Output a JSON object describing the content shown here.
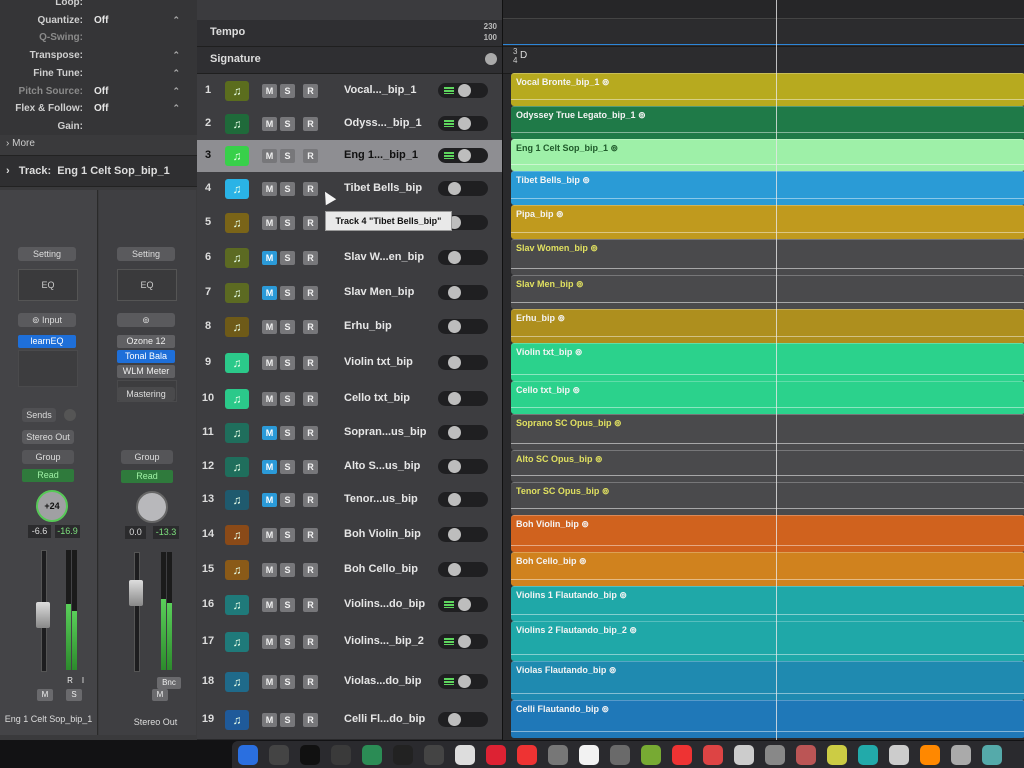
{
  "region_inspector": {
    "params": [
      {
        "label": "Loop:",
        "value": "",
        "chevron": false,
        "dim": false
      },
      {
        "label": "Quantize:",
        "value": "Off",
        "chevron": true,
        "dim": false
      },
      {
        "label": "Q-Swing:",
        "value": "",
        "chevron": false,
        "dim": true
      },
      {
        "label": "Transpose:",
        "value": "",
        "chevron": true,
        "dim": false
      },
      {
        "label": "Fine Tune:",
        "value": "",
        "chevron": true,
        "dim": false
      },
      {
        "label": "Pitch Source:",
        "value": "Off",
        "chevron": true,
        "dim": true
      },
      {
        "label": "Flex & Follow:",
        "value": "Off",
        "chevron": true,
        "dim": false
      },
      {
        "label": "Gain:",
        "value": "",
        "chevron": false,
        "dim": false
      }
    ],
    "more": "More"
  },
  "track_inspector": {
    "title": "Track:",
    "track_name": "Eng 1 Celt Sop_bip_1"
  },
  "strip1": {
    "setting": "Setting",
    "eq": "EQ",
    "input": "Input",
    "plugin": "learnEQ",
    "sends": "Sends",
    "output": "Stereo Out",
    "group": "Group",
    "read": "Read",
    "knob": "+24",
    "vol": "-6.6",
    "peak": "-16.9",
    "ri_r": "R",
    "ri_i": "I",
    "m": "M",
    "s": "S",
    "name": "Eng 1 Celt Sop_bip_1",
    "meter_level": 0.55
  },
  "strip2": {
    "setting": "Setting",
    "eq": "EQ",
    "plugins": [
      "Ozone 12",
      "Tonal Bala",
      "WLM Meter"
    ],
    "mastering": "Mastering",
    "group": "Group",
    "read": "Read",
    "vol": "0.0",
    "peak": "-13.3",
    "m": "M",
    "s": "S",
    "bnc": "Bnc",
    "name": "Stereo Out",
    "meter_level": 0.6
  },
  "global_tracks": {
    "tempo_label": "Tempo",
    "tempo_hi": "230",
    "tempo_lo": "100",
    "signature_label": "Signature",
    "sig_num": "3",
    "sig_den": "4",
    "key": "D"
  },
  "tooltip": "Track 4 \"Tibet Bells_bip\"",
  "tracks": [
    {
      "num": "1",
      "name": "Vocal..._bip_1",
      "m_on": false,
      "on": true,
      "region": "Vocal Bronte_bip_1",
      "color": "#b7aa1f",
      "icon_color": "#5b6d1e"
    },
    {
      "num": "2",
      "name": "Odyss..._bip_1",
      "m_on": false,
      "on": true,
      "region": "Odyssey True Legato_bip_1",
      "color": "#1f7a48",
      "icon_color": "#1f6a3a"
    },
    {
      "num": "3",
      "name": "Eng 1..._bip_1",
      "m_on": false,
      "on": true,
      "region": "Eng 1 Celt Sop_bip_1",
      "color": "#9ef0a8",
      "icon_color": "#38d04a"
    },
    {
      "num": "4",
      "name": "Tibet Bells_bip",
      "m_on": false,
      "on": false,
      "region": "Tibet Bells_bip",
      "color": "#2a9bd6",
      "icon_color": "#2ab3e6"
    },
    {
      "num": "5",
      "name": "",
      "m_on": false,
      "on": false,
      "region": "Pipa_bip",
      "color": "#c09a1e",
      "icon_color": "#7a6418"
    },
    {
      "num": "6",
      "name": "Slav W...en_bip",
      "m_on": true,
      "on": false,
      "region": "Slav Women_bip",
      "color": "#4a4a4c",
      "icon_color": "#5c6a22"
    },
    {
      "num": "7",
      "name": "Slav Men_bip",
      "m_on": true,
      "on": false,
      "region": "Slav Men_bip",
      "color": "#4a4a4c",
      "icon_color": "#5c6a22"
    },
    {
      "num": "8",
      "name": "Erhu_bip",
      "m_on": false,
      "on": false,
      "region": "Erhu_bip",
      "color": "#ae8f1e",
      "icon_color": "#6e5a18"
    },
    {
      "num": "9",
      "name": "Violin txt_bip",
      "m_on": false,
      "on": false,
      "region": "Violin txt_bip",
      "color": "#2bd28c",
      "icon_color": "#2bc98a"
    },
    {
      "num": "10",
      "name": "Cello txt_bip",
      "m_on": false,
      "on": false,
      "region": "Cello txt_bip",
      "color": "#2bd28c",
      "icon_color": "#2bc98a"
    },
    {
      "num": "11",
      "name": "Sopran...us_bip",
      "m_on": true,
      "on": false,
      "region": "Soprano SC Opus_bip",
      "color": "#4a4a4c",
      "icon_color": "#1f6e5c"
    },
    {
      "num": "12",
      "name": "Alto S...us_bip",
      "m_on": true,
      "on": false,
      "region": "Alto SC Opus_bip",
      "color": "#4a4a4c",
      "icon_color": "#1f6e5c"
    },
    {
      "num": "13",
      "name": "Tenor...us_bip",
      "m_on": true,
      "on": false,
      "region": "Tenor SC Opus_bip",
      "color": "#4a4a4c",
      "icon_color": "#1f5a6e"
    },
    {
      "num": "14",
      "name": "Boh Violin_bip",
      "m_on": false,
      "on": false,
      "region": "Boh Violin_bip",
      "color": "#d0621e",
      "icon_color": "#8a4a18"
    },
    {
      "num": "15",
      "name": "Boh Cello_bip",
      "m_on": false,
      "on": false,
      "region": "Boh Cello_bip",
      "color": "#d0821e",
      "icon_color": "#8a5a18"
    },
    {
      "num": "16",
      "name": "Violins...do_bip",
      "m_on": false,
      "on": true,
      "region": "Violins 1 Flautando_bip",
      "color": "#1fa8a8",
      "icon_color": "#1f7a7a"
    },
    {
      "num": "17",
      "name": "Violins..._bip_2",
      "m_on": false,
      "on": true,
      "region": "Violins 2 Flautando_bip_2",
      "color": "#1fa8a8",
      "icon_color": "#1f7a7a"
    },
    {
      "num": "18",
      "name": "Violas...do_bip",
      "m_on": false,
      "on": true,
      "region": "Violas Flautando_bip",
      "color": "#1f8ab0",
      "icon_color": "#1f6a8a"
    },
    {
      "num": "19",
      "name": "Celli Fl...do_bip",
      "m_on": false,
      "on": false,
      "region": "Celli Flautando_bip",
      "color": "#1f78b8",
      "icon_color": "#1f5a9a"
    }
  ],
  "msr": {
    "m": "M",
    "s": "S",
    "r": "R"
  },
  "note_glyph": "♫",
  "loop_glyph": "⊚"
}
